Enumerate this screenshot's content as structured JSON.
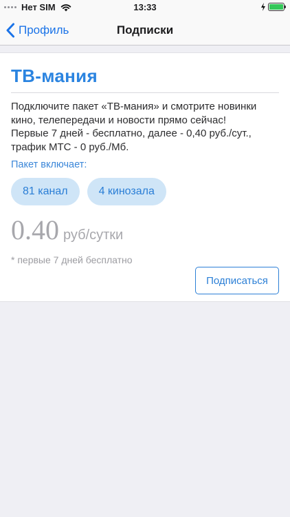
{
  "status_bar": {
    "carrier": "Нет SIM",
    "time": "13:33",
    "battery_level": 1.0
  },
  "nav": {
    "back_label": "Профиль",
    "title": "Подписки"
  },
  "package": {
    "title": "ТВ-мания",
    "description_lines": [
      "Подключите пакет «ТВ-мания» и смотрите новинки",
      "кино, телепередачи и новости прямо сейчас!",
      "Первые 7 дней - бесплатно, далее - 0,40 руб./сут.,",
      "трафик МТС - 0 руб./Мб."
    ],
    "includes_label": "Пакет включает:",
    "chips": [
      "81 канал",
      "4 кинозала"
    ],
    "price": "0.40",
    "price_unit": "руб/сутки",
    "note": "* первые 7 дней бесплатно",
    "subscribe_label": "Подписаться"
  },
  "colors": {
    "accent": "#2b84e0",
    "chip_background": "#cfe5f7",
    "battery": "#34c759",
    "background": "#efeff4"
  },
  "icons": [
    "signal-dots-icon",
    "wifi-icon",
    "charging-icon",
    "battery-icon",
    "chevron-left-icon"
  ]
}
